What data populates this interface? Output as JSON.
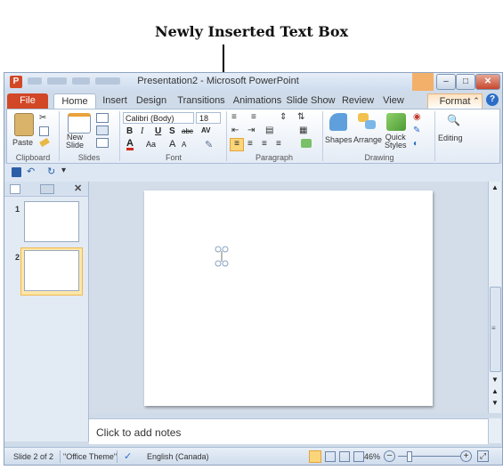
{
  "annotation": {
    "title": "Newly Inserted Text Box"
  },
  "window": {
    "title": "Presentation2 - Microsoft PowerPoint",
    "app_icon": "P",
    "controls": {
      "minimize": "–",
      "maximize": "□",
      "close": "✕"
    }
  },
  "tabs": [
    "File",
    "Home",
    "Insert",
    "Design",
    "Transitions",
    "Animations",
    "Slide Show",
    "Review",
    "View",
    "Format"
  ],
  "ribbon": {
    "clipboard": {
      "paste": "Paste",
      "label": "Clipboard"
    },
    "slides": {
      "new_slide": "New\nSlide",
      "label": "Slides"
    },
    "font": {
      "name": "Calibri (Body)",
      "size": "18",
      "bold": "B",
      "italic": "I",
      "underline": "U",
      "shadow": "S",
      "strike": "abc",
      "spacing": "AV",
      "grow": "A",
      "shrink": "A",
      "case": "Aa",
      "label": "Font"
    },
    "paragraph": {
      "label": "Paragraph"
    },
    "drawing": {
      "shapes": "Shapes",
      "arrange": "Arrange",
      "quick_styles": "Quick\nStyles",
      "label": "Drawing"
    },
    "editing": {
      "label": "Editing"
    }
  },
  "slides_pane": {
    "slide_numbers": [
      "1",
      "2"
    ],
    "selected": 2
  },
  "notes": {
    "placeholder": "Click to add notes"
  },
  "status": {
    "slide_info": "Slide 2 of 2",
    "theme": "\"Office Theme\"",
    "language": "English (Canada)",
    "zoom": "46%"
  },
  "colors": {
    "file_tab": "#d24726",
    "accent": "#2b579a",
    "contextual": "#f3b06a"
  }
}
